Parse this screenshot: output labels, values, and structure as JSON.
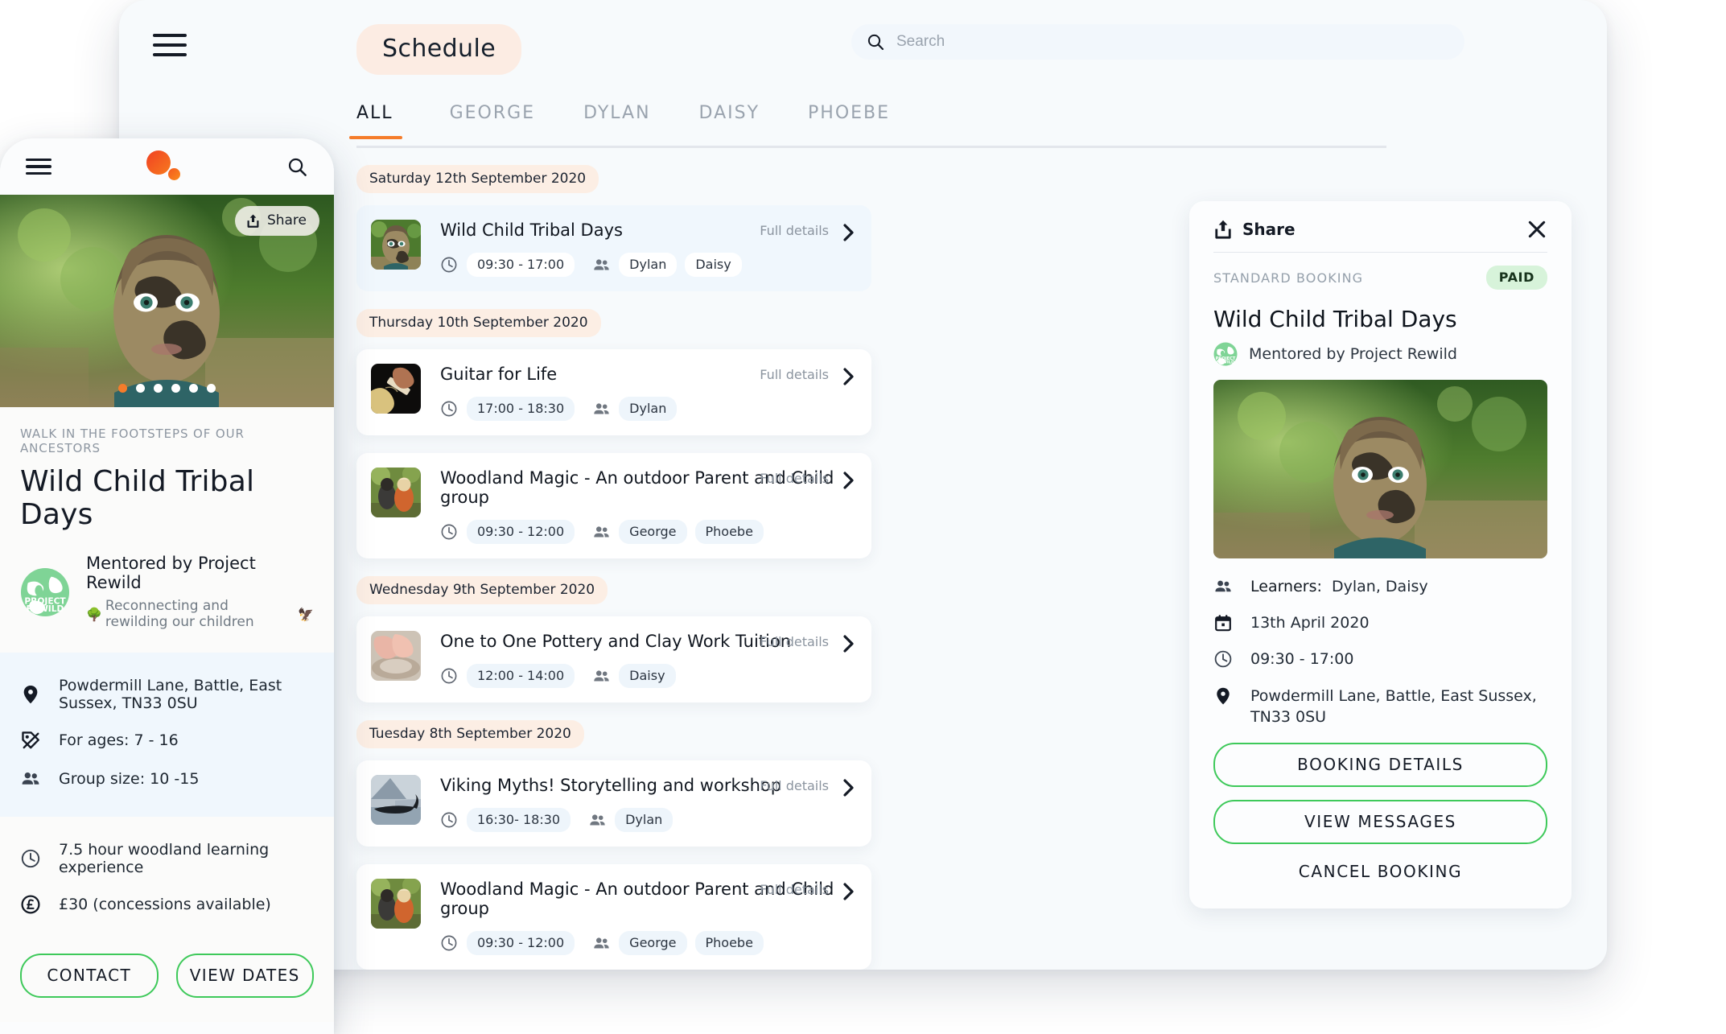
{
  "desktop": {
    "header": {
      "menu_icon": "hamburger-icon",
      "page_pill": "Schedule",
      "search": {
        "icon": "search-icon",
        "placeholder": "Search",
        "value": ""
      }
    },
    "tabs": [
      {
        "label": "ALL",
        "active": true
      },
      {
        "label": "GEORGE",
        "active": false
      },
      {
        "label": "DYLAN",
        "active": false
      },
      {
        "label": "DAISY",
        "active": false
      },
      {
        "label": "PHOEBE",
        "active": false
      }
    ],
    "accent_color": "#f57c2b",
    "groups": [
      {
        "date": "Saturday 12th September 2020",
        "events": [
          {
            "title": "Wild Child Tribal Days",
            "time": "09:30 - 17:00",
            "learners": [
              "Dylan",
              "Daisy"
            ],
            "full_details": "Full details",
            "highlight": true,
            "thumb": "muddy-child-forest"
          }
        ]
      },
      {
        "date": "Thursday 10th September 2020",
        "events": [
          {
            "title": "Guitar for Life",
            "time": "17:00 - 18:30",
            "learners": [
              "Dylan"
            ],
            "full_details": "Full details",
            "highlight": false,
            "thumb": "guitar-hands-dark"
          },
          {
            "title": "Woodland Magic - An outdoor Parent and Child group",
            "time": "09:30 - 12:00",
            "learners": [
              "George",
              "Phoebe"
            ],
            "full_details": "Full details",
            "highlight": false,
            "thumb": "children-woodland"
          }
        ]
      },
      {
        "date": "Wednesday 9th September 2020",
        "events": [
          {
            "title": "One to One Pottery and Clay Work Tuition",
            "time": "12:00 - 14:00",
            "learners": [
              "Daisy"
            ],
            "full_details": "Full details",
            "highlight": false,
            "thumb": "pottery-wheel-hands"
          }
        ]
      },
      {
        "date": "Tuesday 8th September 2020",
        "events": [
          {
            "title": "Viking Myths! Storytelling and workshop",
            "time": "16:30- 18:30",
            "learners": [
              "Dylan"
            ],
            "full_details": "Full details",
            "highlight": false,
            "thumb": "viking-longboat-lake"
          },
          {
            "title": "Woodland Magic - An outdoor Parent and Child group",
            "time": "09:30 - 12:00",
            "learners": [
              "George",
              "Phoebe"
            ],
            "full_details": "Full details",
            "highlight": false,
            "thumb": "children-woodland"
          }
        ]
      }
    ],
    "detail_panel": {
      "share_label": "Share",
      "share_icon": "share-icon",
      "close_icon": "close-icon",
      "booking_type": "STANDARD BOOKING",
      "status_badge": "PAID",
      "status_color": "#d7f3da",
      "title": "Wild Child Tribal Days",
      "mentor": "Mentored by Project Rewild",
      "mentor_logo": "project-rewild-globe-logo",
      "hero_image": "muddy-child-forest",
      "info": [
        {
          "icon": "people-icon",
          "label": "Learners:",
          "value": "Dylan, Daisy"
        },
        {
          "icon": "calendar-icon",
          "label": "",
          "value": "13th April 2020"
        },
        {
          "icon": "clock-icon",
          "label": "",
          "value": "09:30 - 17:00"
        },
        {
          "icon": "location-pin-icon",
          "label": "",
          "value": "Powdermill Lane, Battle, East Sussex, TN33 0SU"
        }
      ],
      "buttons": {
        "booking_details": "BOOKING DETAILS",
        "view_messages": "VIEW MESSAGES",
        "cancel_booking": "CANCEL BOOKING"
      },
      "button_border_color": "#3ec95a"
    }
  },
  "phone": {
    "topbar": {
      "menu_icon": "hamburger-icon",
      "logo": "orange-dots-logo",
      "search_icon": "search-icon"
    },
    "hero": {
      "image": "muddy-child-forest",
      "share_label": "Share",
      "share_icon": "share-icon",
      "carousel_dots": 6,
      "active_dot": 1
    },
    "kicker": "WALK IN THE FOOTSTEPS OF OUR ANCESTORS",
    "title": "Wild Child Tribal Days",
    "mentor": {
      "logo": "project-rewild-globe-logo",
      "name": "Mentored by Project Rewild",
      "tagline": "Reconnecting and rewilding our children",
      "tagline_emoji_start": "🌳",
      "tagline_emoji_end": "🦅"
    },
    "info_primary": [
      {
        "icon": "location-pin-icon",
        "text": "Powdermill Lane, Battle, East Sussex, TN33 0SU"
      },
      {
        "icon": "tag-icon",
        "text": "For ages: 7 - 16"
      },
      {
        "icon": "people-icon",
        "text": "Group size: 10 -15"
      }
    ],
    "info_secondary": [
      {
        "icon": "clock-icon",
        "text": "7.5 hour woodland learning experience"
      },
      {
        "icon": "pound-coin-icon",
        "text": "£30 (concessions available)"
      }
    ],
    "actions": {
      "contact": "CONTACT",
      "view_dates": "VIEW DATES"
    },
    "button_border_color": "#3ec95a"
  }
}
